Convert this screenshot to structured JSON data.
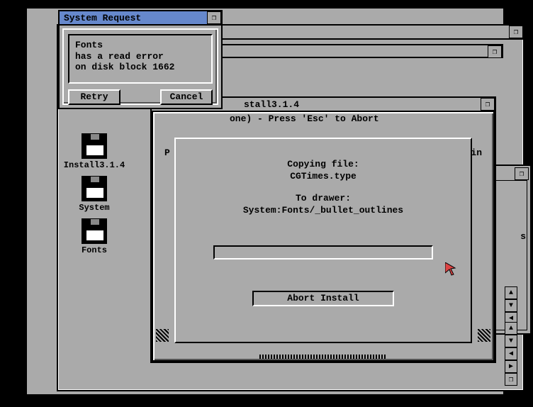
{
  "sysreq": {
    "title": "System Request",
    "msg_l1": "Fonts",
    "msg_l2": "has a read error",
    "msg_l3": "on disk block 1662",
    "retry": "Retry",
    "cancel": "Cancel"
  },
  "bgwin": {
    "title": ""
  },
  "installer": {
    "title_prefix": "stall3.1.4",
    "title_suffix": "one) - Press 'Esc' to Abort",
    "copying_label": "Copying file:",
    "copying_file": "CGTimes.type",
    "to_label": "To drawer:",
    "to_path": "System:Fonts/_bullet_outlines",
    "abort": "Abort Install",
    "left_letter": "P",
    "right_letters": "in"
  },
  "icons": {
    "install": "Install3.1.4",
    "system": "System",
    "fonts": "Fonts"
  },
  "rightfrag": {
    "s": "s"
  }
}
